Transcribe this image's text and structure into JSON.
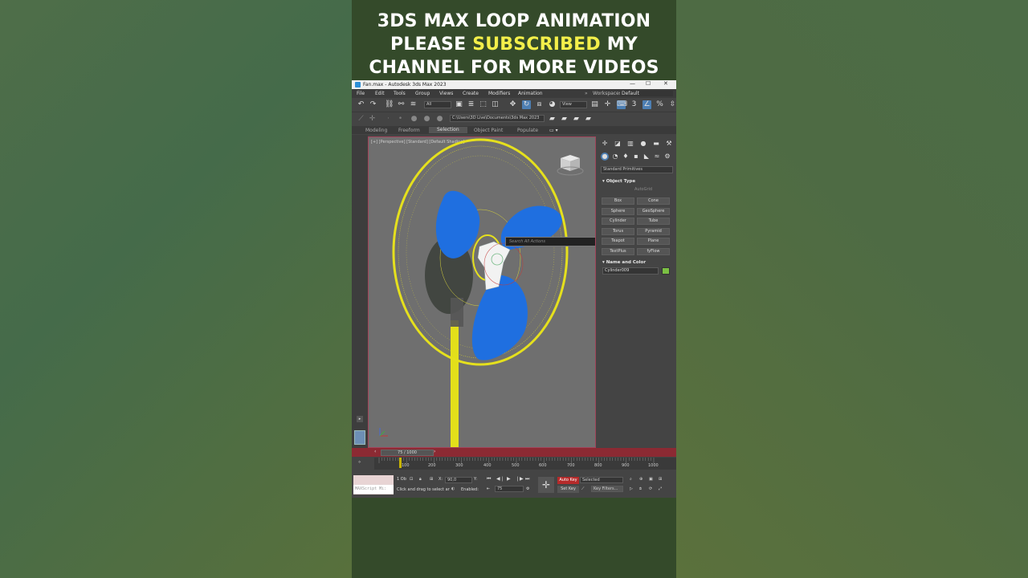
{
  "caption": {
    "line1": "3DS MAX LOOP ANIMATION",
    "line2_prefix": "PLEASE ",
    "line2_highlight": "SUBSCRIBED",
    "line2_suffix": " MY",
    "line3": "CHANNEL FOR MORE VIDEOS"
  },
  "window": {
    "title": "Fan.max - Autodesk 3ds Max 2023",
    "minimize": "—",
    "maximize": "☐",
    "close": "✕"
  },
  "menu": {
    "items": [
      "File",
      "Edit",
      "Tools",
      "Group",
      "Views",
      "Create",
      "Modifiers",
      "Animation"
    ],
    "workspaces_label": "Workspaces:",
    "workspaces_value": "Default"
  },
  "toolbar": {
    "selection_filter": "All",
    "ref_coord": "View",
    "project_path": "C:\\Users\\3D Live\\Documents\\3ds Max 2023"
  },
  "ribbon": {
    "tabs": [
      "Modeling",
      "Freeform",
      "Selection",
      "Object Paint",
      "Populate"
    ],
    "active_tab": "Selection"
  },
  "viewport": {
    "label": "[+] [Perspective] [Standard] [Default Shading]",
    "search_placeholder": "Search All Actions"
  },
  "command_panel": {
    "category": "Standard Primitives",
    "object_type_title": "Object Type",
    "autogrid": "AutoGrid",
    "primitives": [
      "Box",
      "Cone",
      "Sphere",
      "GeoSphere",
      "Cylinder",
      "Tube",
      "Torus",
      "Pyramid",
      "Teapot",
      "Plane",
      "TextPlus",
      "fyFlow"
    ],
    "name_color_title": "Name and Color",
    "object_name": "Cylinder009",
    "object_color": "#7bc043"
  },
  "timeline": {
    "frame_display": "75 / 1000",
    "ticks": [
      "100",
      "200",
      "300",
      "400",
      "500",
      "600",
      "700",
      "800",
      "900",
      "1000"
    ],
    "current_frame": 75,
    "total_frames": 1000
  },
  "status": {
    "maxscript": "MAXScript Mi:",
    "selection_count": "1 Ob",
    "prompt": "Click and drag to select ar",
    "enabled_label": "Enabled:",
    "x_label": "X:",
    "x_value": "90,0",
    "y_label": "Y:",
    "current_frame_field": "75",
    "auto_key": "Auto Key",
    "set_key": "Set Key",
    "key_mode": "Selected",
    "key_filters": "Key Filters..."
  }
}
